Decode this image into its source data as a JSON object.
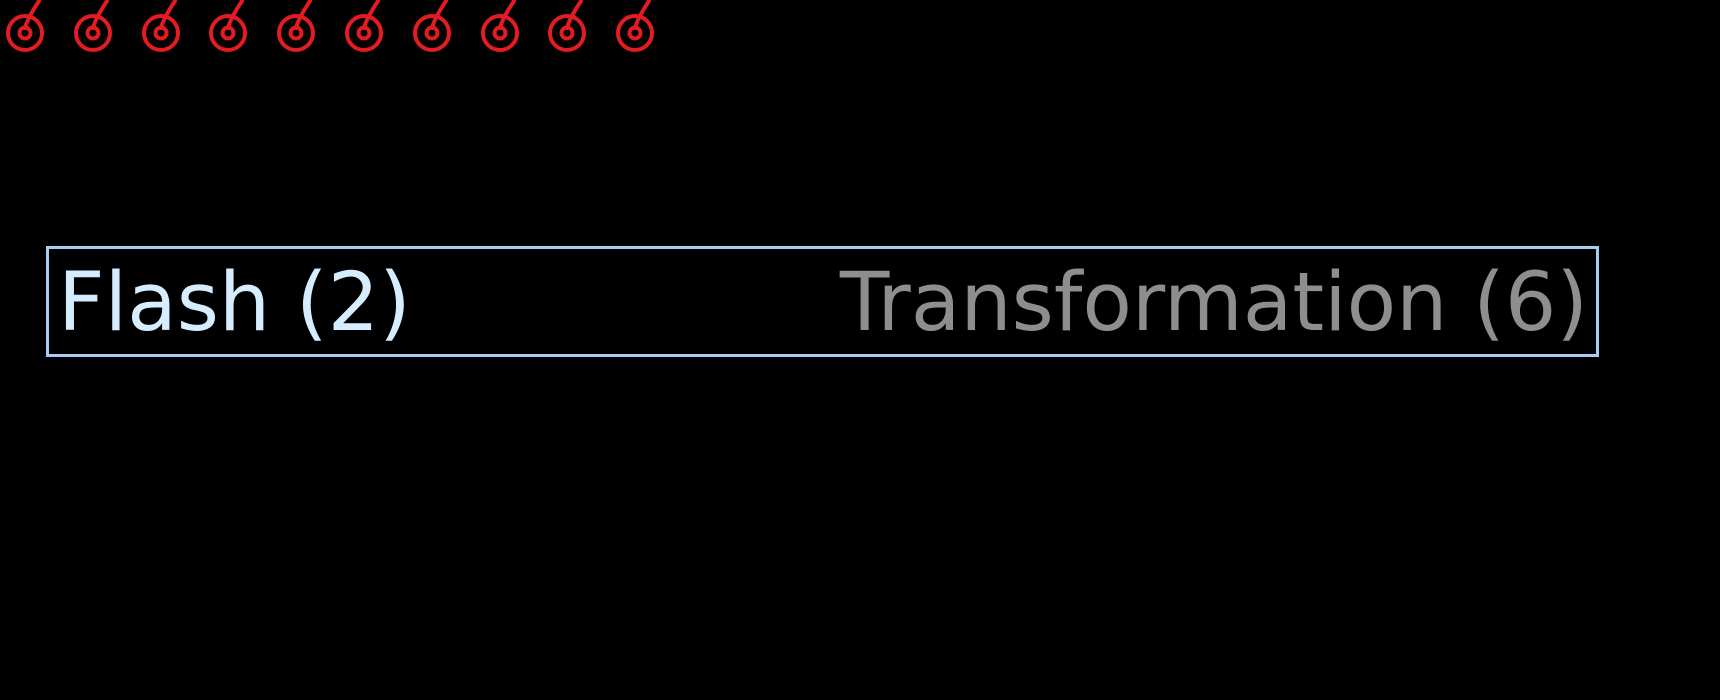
{
  "counters": {
    "icon": "red-spiral-token-icon",
    "color": "#e31b23",
    "count": 10
  },
  "tabs": [
    {
      "label": "Flash (2)",
      "selected": true,
      "color": "#d6ecff"
    },
    {
      "label": "Transformation (6)",
      "selected": false,
      "color": "#8e8e8e"
    }
  ],
  "colors": {
    "background": "#000000",
    "border": "#a8cdf2"
  }
}
